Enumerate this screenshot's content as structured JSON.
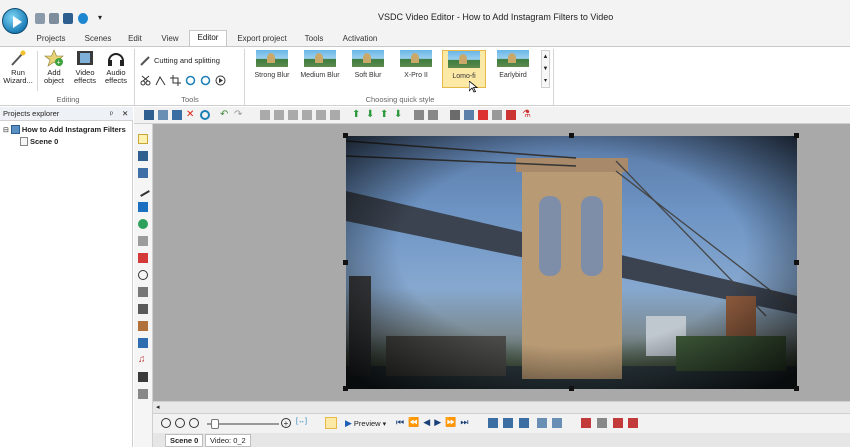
{
  "app": {
    "title": "VSDC Video Editor - How to Add Instagram Filters to Video"
  },
  "menu_tabs": [
    "Projects",
    "Scenes",
    "Edit",
    "View",
    "Editor",
    "Export project",
    "Tools",
    "Activation"
  ],
  "ribbon": {
    "editing": {
      "run_wizard": "Run Wizard...",
      "add_object": "Add object",
      "video_effects": "Video effects",
      "audio_effects": "Audio effects",
      "group_label": "Editing"
    },
    "tools": {
      "cutting_splitting": "Cutting and splitting",
      "group_label": "Tools"
    },
    "quick_style": {
      "group_label": "Choosing quick style",
      "styles": [
        "Strong Blur",
        "Medium Blur",
        "Soft Blur",
        "X-Pro II",
        "Lomo-fi",
        "Earlybird"
      ],
      "selected": "Lomo-fi"
    }
  },
  "explorer": {
    "header": "Projects explorer",
    "project_name": "How to Add Instagram Filters",
    "scene": "Scene 0"
  },
  "timeline": {
    "preview_label": "Preview"
  },
  "scene_tabs": [
    "Scene 0",
    "Video: 0_2"
  ],
  "colors": {
    "accent_blue": "#1d7fb8",
    "selected_style": "#fde9a6",
    "canvas_bg": "#a9a9a9"
  }
}
